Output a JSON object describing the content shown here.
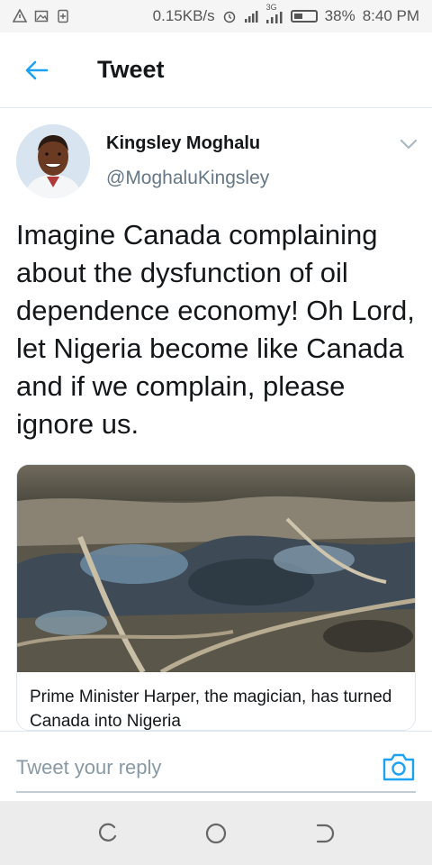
{
  "status_bar": {
    "network_speed": "0.15KB/s",
    "network_type": "3G",
    "battery": "38%",
    "time": "8:40 PM",
    "icons": [
      "warning-icon",
      "image-icon",
      "sim-icon",
      "alarm-icon",
      "signal-icon",
      "signal-3g-icon",
      "battery-icon"
    ]
  },
  "header": {
    "title": "Tweet",
    "back_icon": "arrow-left-icon",
    "accent_color": "#1da1f2"
  },
  "tweet": {
    "display_name": "Kingsley Moghalu",
    "handle": "@MoghaluKingsley",
    "text": "Imagine Canada complaining about the dysfunction of oil dependence economy! Oh Lord, let Nigeria become like Canada and if we complain, please ignore us.",
    "card": {
      "caption": "Prime Minister Harper, the magician, has turned Canada into Nigeria"
    }
  },
  "reply": {
    "placeholder": "Tweet your reply",
    "camera_icon": "camera-icon"
  },
  "nav": {
    "icons": [
      "recent-apps-icon",
      "home-icon",
      "back-icon"
    ]
  }
}
